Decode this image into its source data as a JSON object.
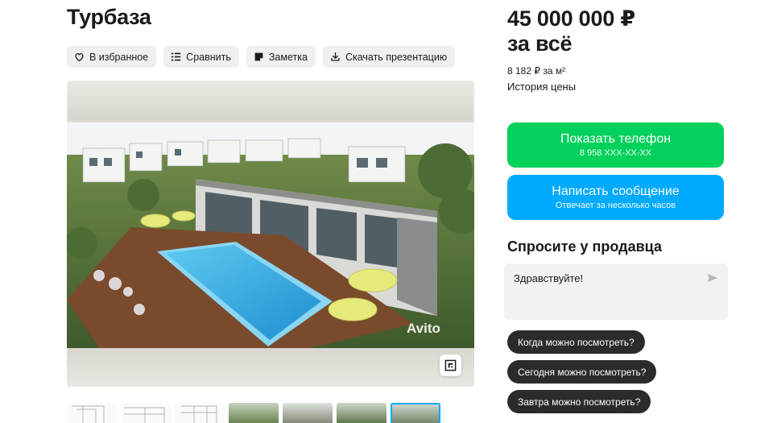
{
  "listing": {
    "title": "Турбаза"
  },
  "actions": [
    {
      "icon": "heart-icon",
      "label": "В избранное"
    },
    {
      "icon": "compare-icon",
      "label": "Сравнить"
    },
    {
      "icon": "note-icon",
      "label": "Заметка"
    },
    {
      "icon": "download-icon",
      "label": "Скачать презентацию"
    }
  ],
  "gallery": {
    "watermark": "Avito",
    "thumb_count": 7,
    "active_thumb": 7
  },
  "price": {
    "amount": "45 000 000 ₽",
    "suffix": "за всё",
    "per_m2": "8 182 ₽ за м²",
    "history_label": "История цены"
  },
  "contact": {
    "phone_label": "Показать телефон",
    "phone_masked": "8 958 XXX-XX-XX",
    "message_label": "Написать сообщение",
    "message_sub": "Отвечает за несколько часов",
    "phone_color": "#02d15c",
    "message_color": "#00aaff"
  },
  "ask": {
    "title": "Спросите у продавца",
    "input_value": "Здравствуйте!",
    "chips": [
      "Когда можно посмотреть?",
      "Сегодня можно посмотреть?",
      "Завтра можно посмотреть?"
    ]
  }
}
